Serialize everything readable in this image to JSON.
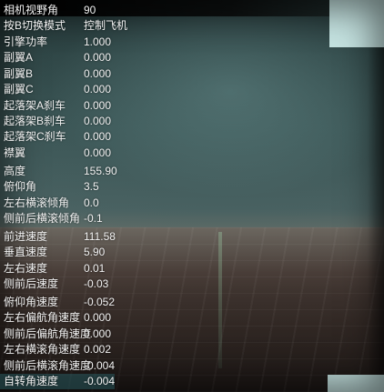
{
  "colors": {
    "corner_accent": "#c5e3e1",
    "text": "#f2f2f2"
  },
  "hud_groups": [
    {
      "name": "view",
      "rows": [
        {
          "label": "相机视野角",
          "value": "90"
        },
        {
          "label": "按B切换模式",
          "value": "控制飞机"
        }
      ]
    },
    {
      "name": "controls",
      "rows": [
        {
          "label": "引擎功率",
          "value": "1.000"
        },
        {
          "label": "副翼A",
          "value": "0.000"
        },
        {
          "label": "副翼B",
          "value": "0.000"
        },
        {
          "label": "副翼C",
          "value": "0.000"
        },
        {
          "label": "起落架A刹车",
          "value": "0.000"
        },
        {
          "label": "起落架B刹车",
          "value": "0.000"
        },
        {
          "label": "起落架C刹车",
          "value": "0.000"
        },
        {
          "label": "襟翼",
          "value": "0.000"
        }
      ]
    },
    {
      "name": "attitude",
      "rows": [
        {
          "label": "高度",
          "value": "155.90"
        },
        {
          "label": "俯仰角",
          "value": "3.5"
        },
        {
          "label": "左右横滚倾角",
          "value": "0.0"
        },
        {
          "label": "侧前后横滚倾角",
          "value": "-0.1"
        }
      ]
    },
    {
      "name": "velocity",
      "rows": [
        {
          "label": "前进速度",
          "value": "111.58"
        },
        {
          "label": "垂直速度",
          "value": "5.90"
        },
        {
          "label": "左右速度",
          "value": "0.01"
        },
        {
          "label": "侧前后速度",
          "value": "-0.03"
        }
      ]
    },
    {
      "name": "angular_velocity",
      "rows": [
        {
          "label": "俯仰角速度",
          "value": "-0.052"
        },
        {
          "label": "左右偏航角速度",
          "value": "0.000"
        },
        {
          "label": "侧前后偏航角速度",
          "value": "0.000"
        },
        {
          "label": "左右横滚角速度",
          "value": "0.002"
        },
        {
          "label": "侧前后横滚角速度",
          "value": "-0.004"
        },
        {
          "label": "自转角速度",
          "value": "-0.004"
        }
      ]
    }
  ]
}
